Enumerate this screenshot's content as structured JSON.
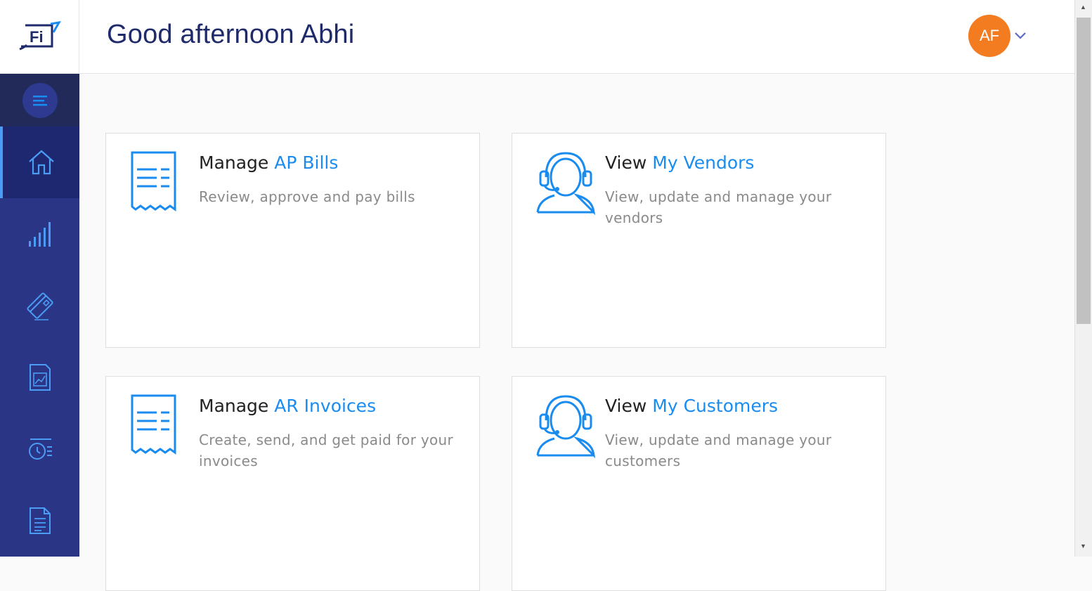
{
  "header": {
    "greeting": "Good afternoon Abhi",
    "avatar_initials": "AF"
  },
  "logo": {
    "text": "Fi"
  },
  "sidebar": {
    "items": [
      {
        "icon": "home-icon",
        "active": true
      },
      {
        "icon": "bar-chart-icon",
        "active": false
      },
      {
        "icon": "credit-card-icon",
        "active": false
      },
      {
        "icon": "report-chart-icon",
        "active": false
      },
      {
        "icon": "clock-list-icon",
        "active": false
      },
      {
        "icon": "document-icon",
        "active": false
      }
    ]
  },
  "cards": [
    {
      "title_prefix": "Manage",
      "title_accent": "AP Bills",
      "description": "Review, approve and pay bills",
      "icon": "bill-receipt-icon"
    },
    {
      "title_prefix": "View",
      "title_accent": "My Vendors",
      "description": "View, update and manage your vendors",
      "icon": "headset-person-icon"
    },
    {
      "title_prefix": "Manage",
      "title_accent": "AR Invoices",
      "description": "Create, send, and get paid for your invoices",
      "icon": "invoice-receipt-icon"
    },
    {
      "title_prefix": "View",
      "title_accent": "My Customers",
      "description": "View, update and manage your customers",
      "icon": "headset-person-icon"
    }
  ],
  "colors": {
    "sidebar": "#2b3585",
    "accent": "#1a8cf0",
    "avatar": "#f47c20",
    "greeting": "#1f2a6b"
  }
}
